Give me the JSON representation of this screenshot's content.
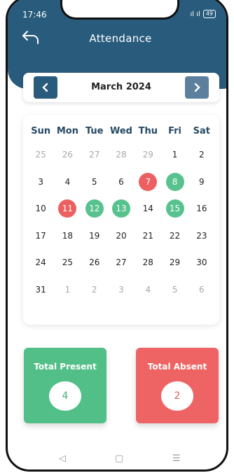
{
  "status": {
    "time": "17:46",
    "signal": "ıl ıl",
    "battery": "49"
  },
  "header": {
    "title": "Attendance"
  },
  "month_nav": {
    "label": "March 2024",
    "prev": "‹",
    "next": "›"
  },
  "calendar": {
    "weekdays": [
      "Sun",
      "Mon",
      "Tue",
      "Wed",
      "Thu",
      "Fri",
      "Sat"
    ],
    "days": [
      {
        "n": "25",
        "s": "muted"
      },
      {
        "n": "26",
        "s": "muted"
      },
      {
        "n": "27",
        "s": "muted"
      },
      {
        "n": "28",
        "s": "muted"
      },
      {
        "n": "29",
        "s": "muted"
      },
      {
        "n": "1",
        "s": ""
      },
      {
        "n": "2",
        "s": ""
      },
      {
        "n": "3",
        "s": ""
      },
      {
        "n": "4",
        "s": ""
      },
      {
        "n": "5",
        "s": ""
      },
      {
        "n": "6",
        "s": ""
      },
      {
        "n": "7",
        "s": "absent"
      },
      {
        "n": "8",
        "s": "present"
      },
      {
        "n": "9",
        "s": ""
      },
      {
        "n": "10",
        "s": ""
      },
      {
        "n": "11",
        "s": "absent"
      },
      {
        "n": "12",
        "s": "present"
      },
      {
        "n": "13",
        "s": "present"
      },
      {
        "n": "14",
        "s": ""
      },
      {
        "n": "15",
        "s": "present"
      },
      {
        "n": "16",
        "s": ""
      },
      {
        "n": "17",
        "s": ""
      },
      {
        "n": "18",
        "s": ""
      },
      {
        "n": "19",
        "s": ""
      },
      {
        "n": "20",
        "s": ""
      },
      {
        "n": "21",
        "s": ""
      },
      {
        "n": "22",
        "s": ""
      },
      {
        "n": "23",
        "s": ""
      },
      {
        "n": "24",
        "s": ""
      },
      {
        "n": "25",
        "s": ""
      },
      {
        "n": "26",
        "s": ""
      },
      {
        "n": "27",
        "s": ""
      },
      {
        "n": "28",
        "s": ""
      },
      {
        "n": "29",
        "s": ""
      },
      {
        "n": "30",
        "s": ""
      },
      {
        "n": "31",
        "s": ""
      },
      {
        "n": "1",
        "s": "muted"
      },
      {
        "n": "2",
        "s": "muted"
      },
      {
        "n": "3",
        "s": "muted"
      },
      {
        "n": "4",
        "s": "muted"
      },
      {
        "n": "5",
        "s": "muted"
      },
      {
        "n": "6",
        "s": "muted"
      }
    ]
  },
  "summary": {
    "present_label": "Total Present",
    "present_value": "4",
    "absent_label": "Total Absent",
    "absent_value": "2"
  },
  "nav": {
    "back": "◁",
    "home": "▢",
    "menu": "☰"
  },
  "colors": {
    "header": "#295b7c",
    "present": "#57c28d",
    "absent": "#ec6061"
  }
}
